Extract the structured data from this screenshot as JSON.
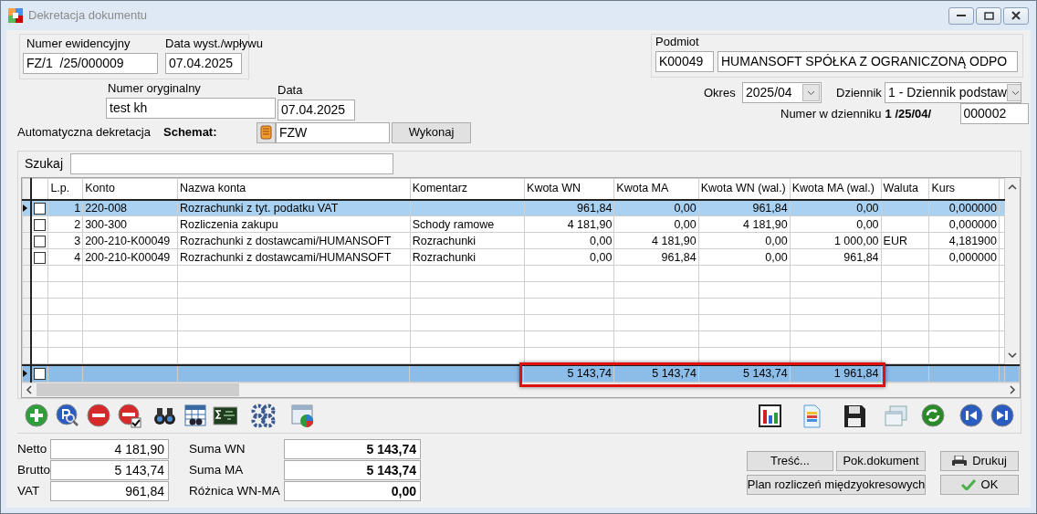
{
  "window": {
    "title": "Dekretacja dokumentu"
  },
  "document": {
    "number_label": "Numer ewidencyjny",
    "number": "FZ/1  /25/000009",
    "issue_date_label": "Data wyst./wpływu",
    "issue_date": "07.04.2025",
    "original_number_label": "Numer oryginalny",
    "original_number": "test kh",
    "date_label": "Data",
    "date": "07.04.2025"
  },
  "auto_posting": {
    "label": "Automatyczna dekretacja",
    "scheme_label": "Schemat:",
    "scheme": "FZW",
    "run_button": "Wykonaj"
  },
  "entity": {
    "label": "Podmiot",
    "code": "K00049",
    "name": "HUMANSOFT SPÓŁKA Z OGRANICZONĄ ODPO"
  },
  "period": {
    "label": "Okres",
    "value": "2025/04"
  },
  "journal": {
    "label": "Dziennik",
    "value": "1  - Dziennik podstaw",
    "number_label": "Numer w dzienniku",
    "number_prefix": "1 /25/04/",
    "number": "000002"
  },
  "search": {
    "label": "Szukaj"
  },
  "table": {
    "columns": [
      "L.p.",
      "Konto",
      "Nazwa konta",
      "Komentarz",
      "Kwota WN",
      "Kwota MA",
      "Kwota WN (wal.)",
      "Kwota MA (wal.)",
      "Waluta",
      "Kurs"
    ],
    "rows": [
      {
        "selected": true,
        "checked": false,
        "cells": [
          "1",
          "220-008",
          "Rozrachunki z tyt. podatku VAT",
          "",
          "961,84",
          "0,00",
          "961,84",
          "0,00",
          "",
          "0,000000"
        ]
      },
      {
        "selected": false,
        "checked": false,
        "cells": [
          "2",
          "300-300",
          "Rozliczenia zakupu",
          "Schody ramowe",
          "4 181,90",
          "0,00",
          "4 181,90",
          "0,00",
          "",
          "0,000000"
        ]
      },
      {
        "selected": false,
        "checked": false,
        "cells": [
          "3",
          "200-210-K00049",
          "Rozrachunki z dostawcami/HUMANSOFT",
          "Rozrachunki",
          "0,00",
          "4 181,90",
          "0,00",
          "1 000,00",
          "EUR",
          "4,181900"
        ]
      },
      {
        "selected": false,
        "checked": false,
        "cells": [
          "4",
          "200-210-K00049",
          "Rozrachunki z dostawcami/HUMANSOFT",
          "Rozrachunki",
          "0,00",
          "961,84",
          "0,00",
          "961,84",
          "",
          "0,000000"
        ]
      }
    ],
    "totals": {
      "checked": false,
      "highlighted": true,
      "values": [
        "5 143,74",
        "5 143,74",
        "5 143,74",
        "1 961,84"
      ]
    }
  },
  "summary": [
    {
      "label": "Netto",
      "value": "4 181,90"
    },
    {
      "label": "Brutto",
      "value": "5 143,74"
    },
    {
      "label": "VAT",
      "value": "961,84"
    }
  ],
  "balance": [
    {
      "label": "Suma WN",
      "value": "5 143,74"
    },
    {
      "label": "Suma MA",
      "value": "5 143,74"
    },
    {
      "label": "Różnica WN-MA",
      "value": "0,00"
    }
  ],
  "buttons": [
    {
      "label": "Treść...",
      "kind": "plain"
    },
    {
      "label": "Pok.dokument",
      "kind": "plain"
    },
    {
      "label": "Drukuj",
      "kind": "print"
    },
    {
      "label": "Plan rozliczeń międzyokresowych",
      "kind": "plain"
    },
    {
      "label": "OK",
      "kind": "ok"
    }
  ]
}
